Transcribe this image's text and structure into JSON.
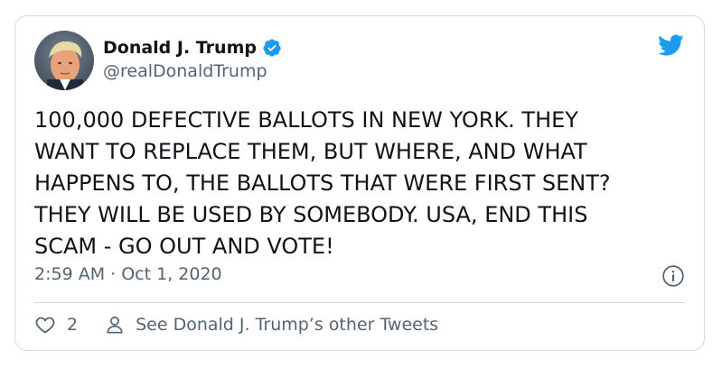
{
  "author": {
    "display_name": "Donald J. Trump",
    "handle": "@realDonaldTrump",
    "verified": true,
    "avatar_icon": "avatar-photo"
  },
  "tweet": {
    "text": "100,000 DEFECTIVE BALLOTS IN NEW YORK. THEY\nWANT TO REPLACE THEM, BUT WHERE, AND WHAT\nHAPPENS TO, THE BALLOTS THAT WERE FIRST SENT?\nTHEY WILL BE USED BY SOMEBODY. USA, END THIS\nSCAM - GO OUT AND VOTE!",
    "timestamp": "2:59 AM · Oct 1, 2020"
  },
  "actions": {
    "like_count": "2",
    "profile_link": "See Donald J. Trump’s other Tweets"
  },
  "icons": {
    "brand": "twitter-bird-icon",
    "verified": "verified-badge-icon",
    "info": "info-icon",
    "like": "heart-icon",
    "profile": "person-icon"
  },
  "colors": {
    "brand": "#1d9bf0",
    "text": "#0f1419",
    "secondary": "#536471",
    "border": "#cfd9de"
  }
}
